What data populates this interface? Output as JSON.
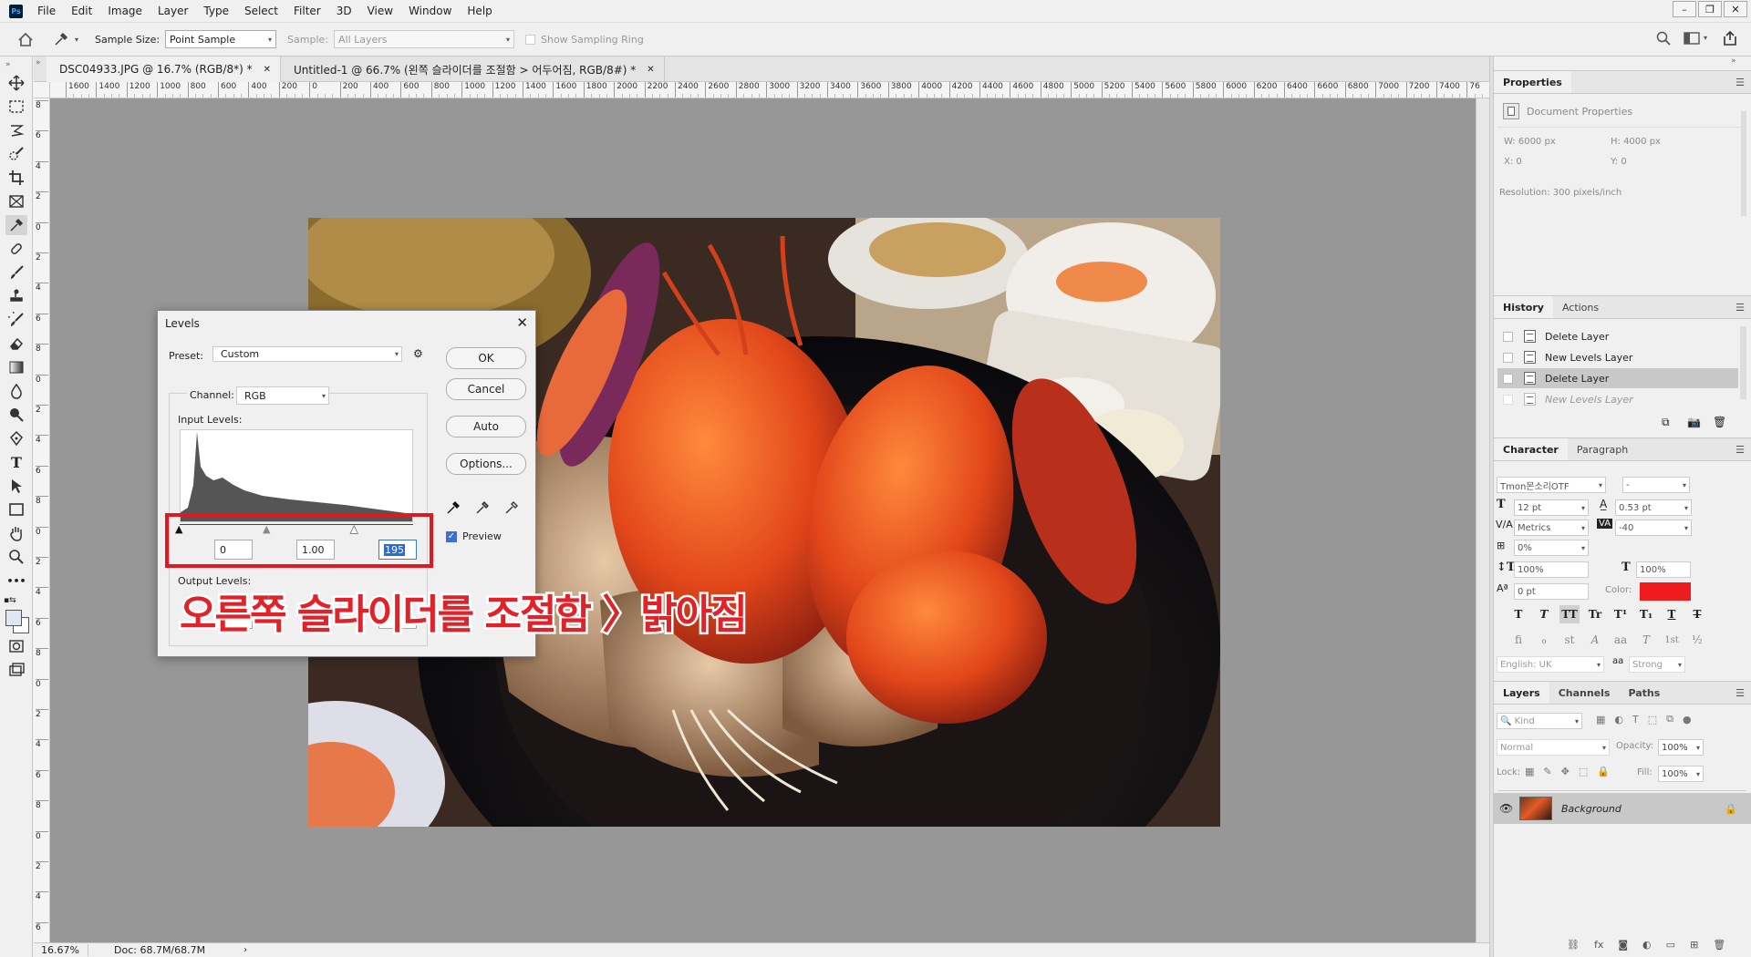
{
  "app": {
    "logo": "Ps"
  },
  "menu": [
    "File",
    "Edit",
    "Image",
    "Layer",
    "Type",
    "Select",
    "Filter",
    "3D",
    "View",
    "Window",
    "Help"
  ],
  "window_controls": [
    "minimize-icon",
    "restore-icon",
    "close-icon"
  ],
  "options_bar": {
    "sample_size_label": "Sample Size:",
    "sample_size_value": "Point Sample",
    "sample_label": "Sample:",
    "sample_value": "All Layers",
    "show_sampling_ring": "Show Sampling Ring"
  },
  "tabs": [
    {
      "label": "DSC04933.JPG @ 16.7% (RGB/8*) *",
      "active": true
    },
    {
      "label": "Untitled-1 @ 66.7% (왼쪽 슬라이더를 조절함 > 어두어짐, RGB/8#) *",
      "active": false
    }
  ],
  "ruler_h": [
    "1600",
    "1400",
    "1200",
    "1000",
    "800",
    "600",
    "400",
    "200",
    "0",
    "200",
    "400",
    "600",
    "800",
    "1000",
    "1200",
    "1400",
    "1600",
    "1800",
    "2000",
    "2200",
    "2400",
    "2600",
    "2800",
    "3000",
    "3200",
    "3400",
    "3600",
    "3800",
    "4000",
    "4200",
    "4400",
    "4600",
    "4800",
    "5000",
    "5200",
    "5400",
    "5600",
    "5800",
    "6000",
    "6200",
    "6400",
    "6600",
    "6800",
    "7000",
    "7200",
    "7400",
    "76"
  ],
  "ruler_v": [
    "8",
    "6",
    "4",
    "2",
    "0",
    "2",
    "4",
    "6",
    "8",
    "0",
    "2",
    "4",
    "6",
    "8",
    "0",
    "2",
    "4",
    "6",
    "8",
    "0",
    "2",
    "4",
    "6",
    "8",
    "0",
    "2",
    "4",
    "6",
    "8",
    "0"
  ],
  "status": {
    "zoom": "16.67%",
    "doc": "Doc: 68.7M/68.7M"
  },
  "levels": {
    "title": "Levels",
    "preset_label": "Preset:",
    "preset_value": "Custom",
    "ok": "OK",
    "cancel": "Cancel",
    "auto": "Auto",
    "options": "Options...",
    "channel_label": "Channel:",
    "channel_value": "RGB",
    "input_levels_label": "Input Levels:",
    "input_black": "0",
    "input_gamma": "1.00",
    "input_white": "195",
    "output_levels_label": "Output Levels:",
    "preview_label": "Preview",
    "preview_checked": true
  },
  "overlay_caption": "오른쪽 슬라이더를 조절함 〉밝아짐",
  "properties": {
    "tab": "Properties",
    "doc_props": "Document Properties",
    "w": "W:  6000 px",
    "h": "H:  4000 px",
    "x": "X:  0",
    "y": "Y:  0",
    "resolution": "Resolution: 300 pixels/inch"
  },
  "history": {
    "tabs": [
      "History",
      "Actions"
    ],
    "items": [
      {
        "label": "Delete Layer",
        "state": "normal"
      },
      {
        "label": "New Levels Layer",
        "state": "normal"
      },
      {
        "label": "Delete Layer",
        "state": "selected"
      },
      {
        "label": "New Levels Layer",
        "state": "undone"
      }
    ]
  },
  "character": {
    "tabs": [
      "Character",
      "Paragraph"
    ],
    "font_family": "Tmon몬소리OTF",
    "font_style": "-",
    "font_size": "12 pt",
    "leading": "0.53 pt",
    "kerning": "Metrics",
    "tracking": "-40",
    "scale_pct": "0%",
    "vscale": "100%",
    "hscale": "100%",
    "baseline": "0 pt",
    "color_label": "Color:",
    "color_value": "#ee1c1c",
    "language": "English: UK",
    "aa_label": "aa",
    "antialias": "Strong",
    "format_buttons": [
      "T",
      "T",
      "TT",
      "Tr",
      "T¹",
      "T₁",
      "T",
      "T"
    ],
    "opentype_buttons": [
      "fi",
      "ℴ",
      "st",
      "A",
      "aa",
      "T",
      "1st",
      "½"
    ]
  },
  "layers": {
    "tabs": [
      "Layers",
      "Channels",
      "Paths"
    ],
    "kind": "Kind",
    "blend_mode": "Normal",
    "opacity_label": "Opacity:",
    "opacity_value": "100%",
    "lock_label": "Lock:",
    "fill_label": "Fill:",
    "fill_value": "100%",
    "layer_name": "Background"
  }
}
